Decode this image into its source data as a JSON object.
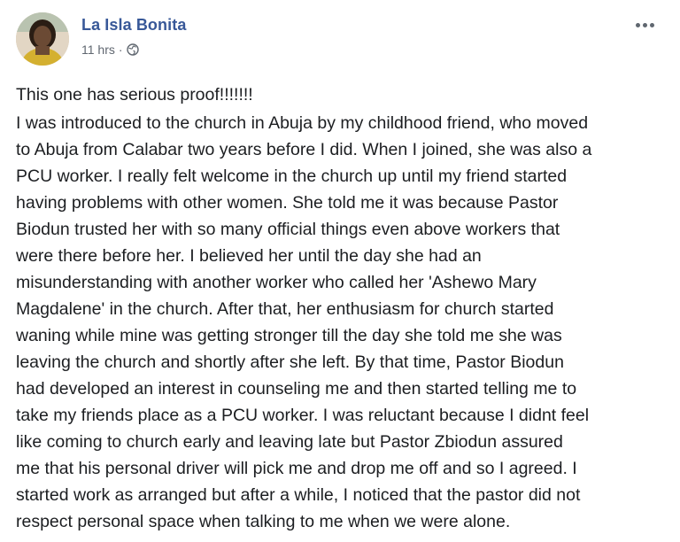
{
  "post": {
    "author": "La Isla Bonita",
    "timestamp": "11 hrs",
    "separator": "·",
    "privacy_icon": "globe-icon",
    "more_icon": "more-options-icon",
    "headline": "This one has serious proof!!!!!!!",
    "body_lines": [
      "I was introduced to the church in Abuja by my childhood friend, who moved",
      "to Abuja from Calabar two years before I did. When I joined, she was also a",
      "PCU worker. I really felt welcome in the church up until my friend started",
      "having problems with other women. She told me it was because Pastor",
      "Biodun trusted her with so many official things even above workers that",
      "were there before her. I believed her until the day she had an",
      "misunderstanding with another worker who called her 'Ashewo Mary",
      "Magdalene' in the church. After that, her enthusiasm for church started",
      "waning while mine was getting stronger till the day she told me she was",
      "leaving the church and shortly after she left. By that time, Pastor Biodun",
      "had developed an interest in counseling me and then started telling me to",
      "take my friends place as a PCU worker. I was reluctant because I didnt feel",
      "like coming to church early and leaving late but Pastor Zbiodun assured",
      "me that his personal driver will pick me and drop me off and so I agreed. I",
      "started work as arranged but after a while, I noticed that the pastor did not",
      "respect personal space when talking to me when we were alone."
    ]
  },
  "colors": {
    "author_name": "#385898",
    "meta_text": "#606770",
    "body_text": "#1c1e21",
    "background": "#ffffff"
  }
}
